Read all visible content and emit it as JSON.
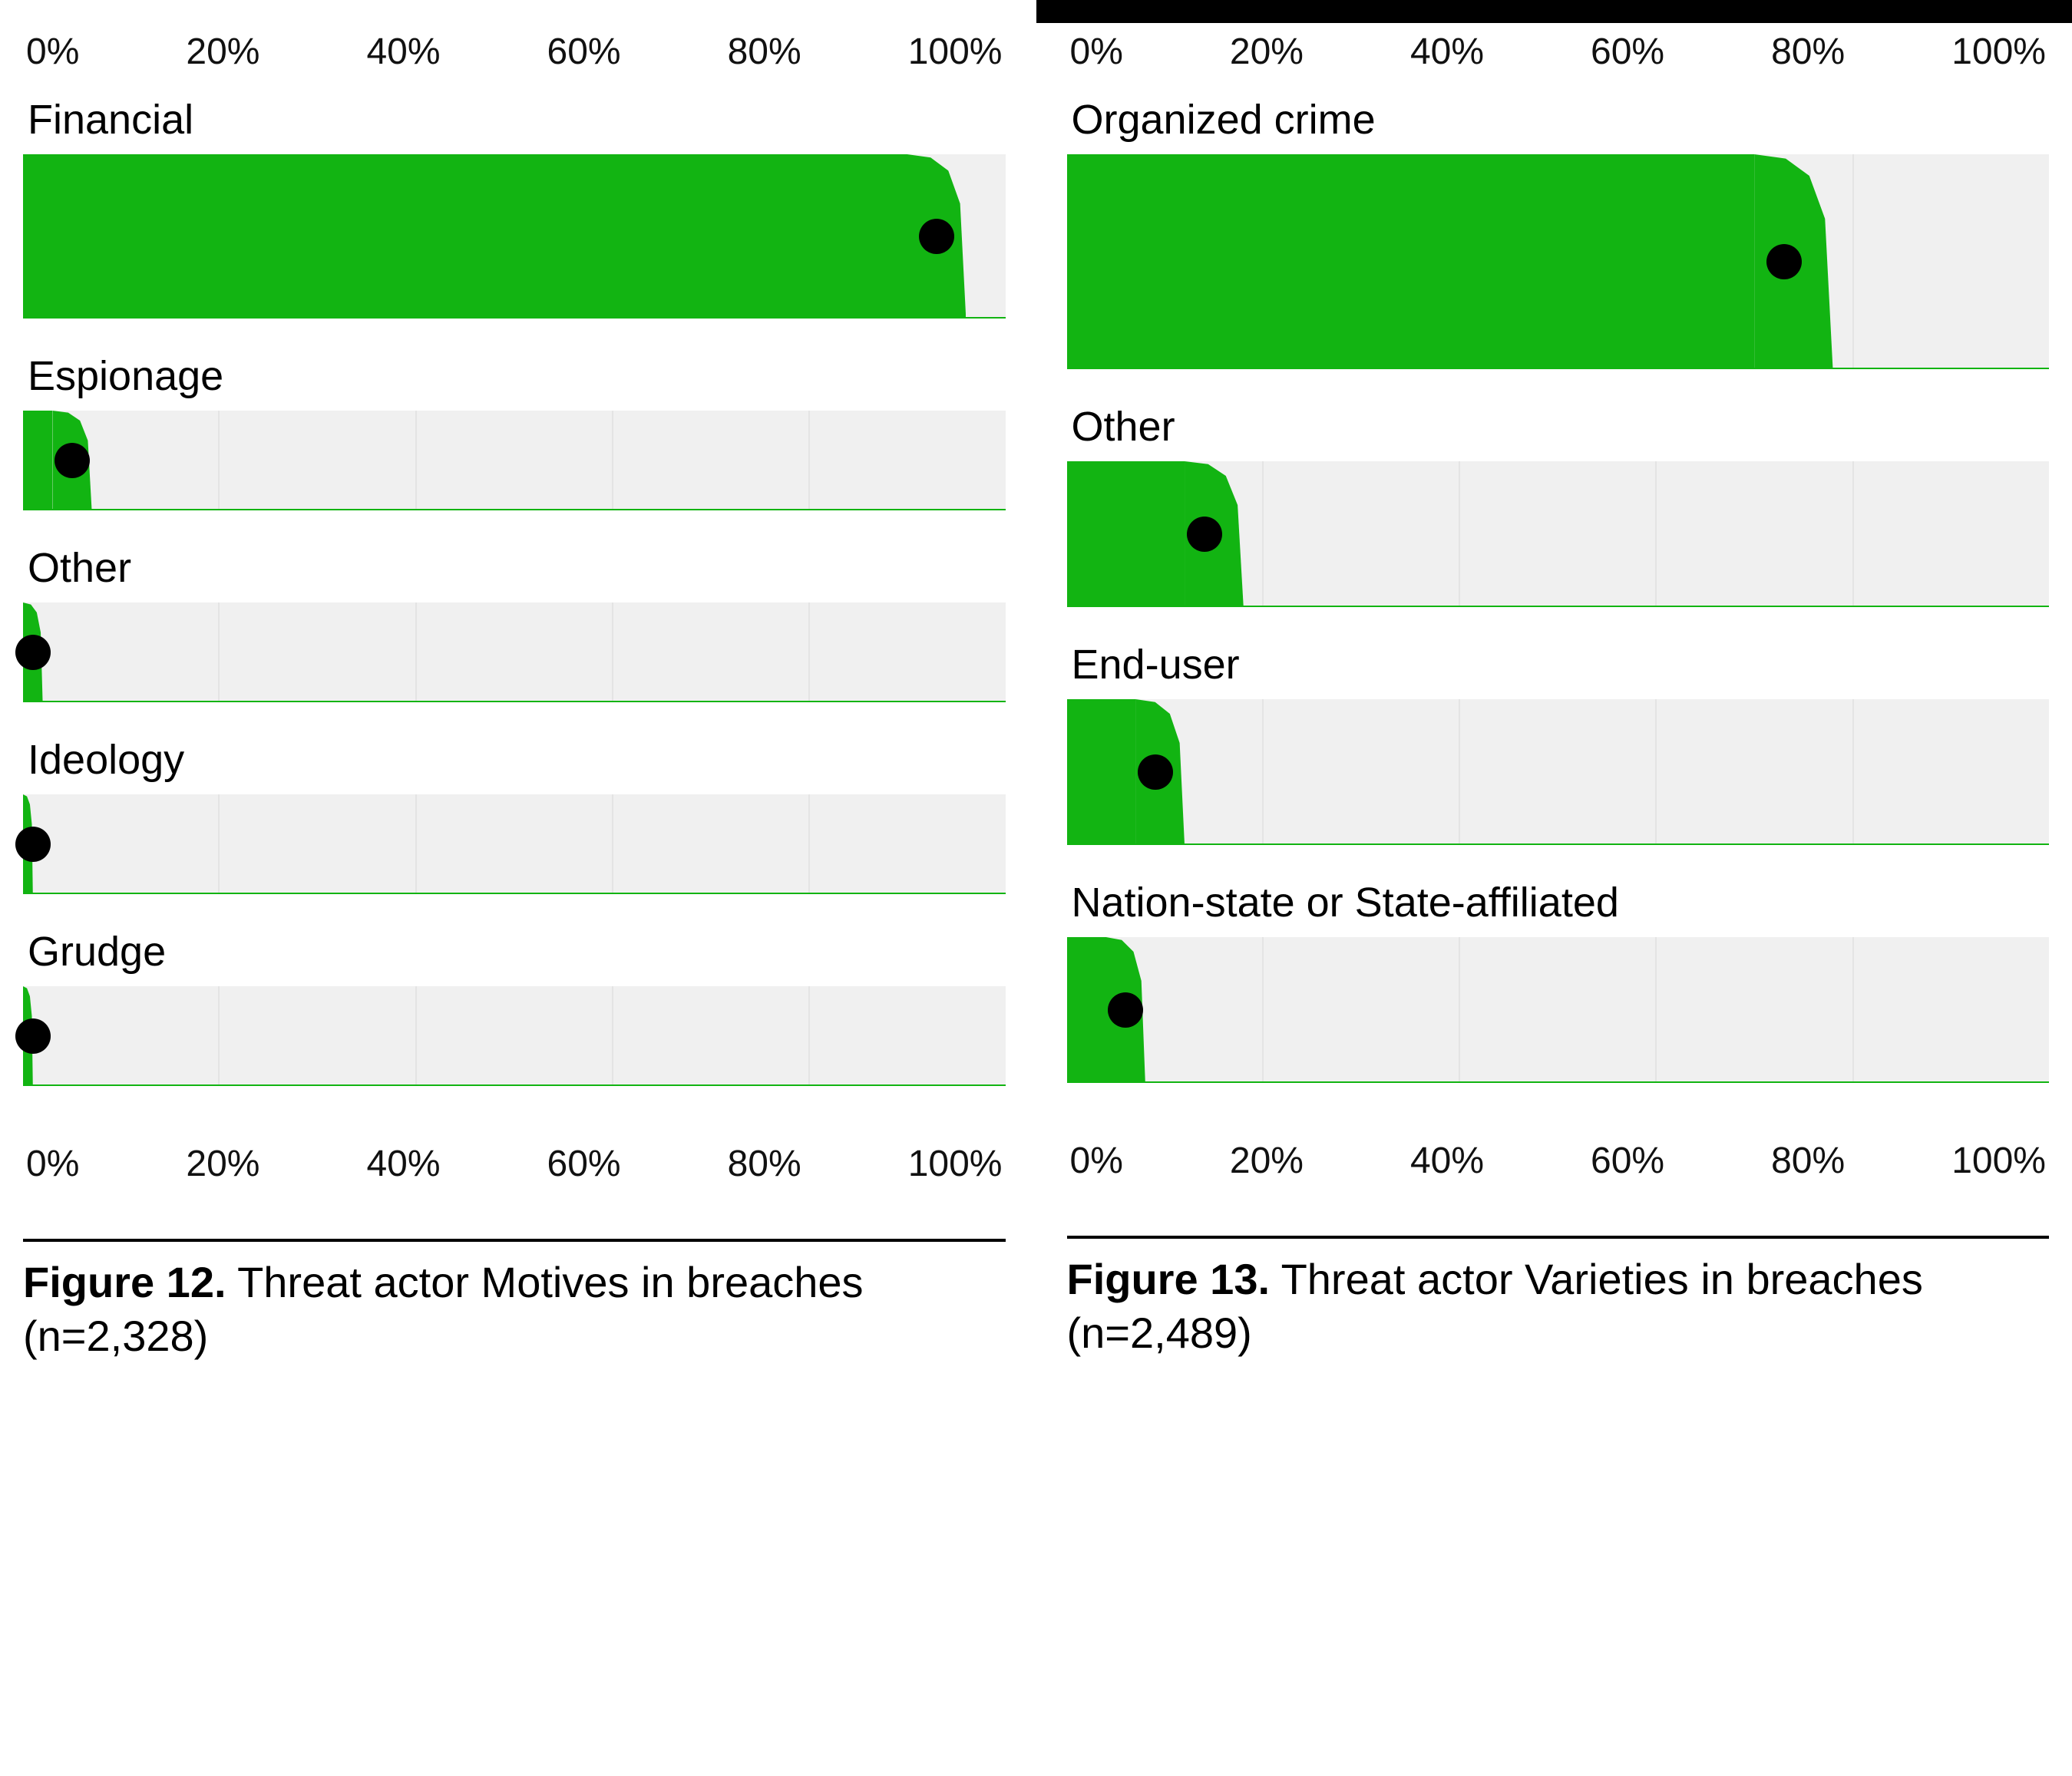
{
  "axis_ticks": [
    "0%",
    "20%",
    "40%",
    "60%",
    "80%",
    "100%"
  ],
  "colors": {
    "bar": "#12b412",
    "dot": "#000000",
    "grid_bg": "#f0f0f0"
  },
  "chart_data": [
    {
      "id": "fig12",
      "type": "bar",
      "orientation": "horizontal",
      "title": "Threat actor Motives in breaches (n=2,328)",
      "figure_label": "Figure 12.",
      "xlim": [
        0,
        100
      ],
      "x_ticks": [
        0,
        20,
        40,
        60,
        80,
        100
      ],
      "first_bar_height": 214,
      "other_bar_height": 130,
      "series": [
        {
          "name": "Financial",
          "value": 93,
          "low": 90,
          "high": 96
        },
        {
          "name": "Espionage",
          "value": 5,
          "low": 3,
          "high": 7
        },
        {
          "name": "Other",
          "value": 1,
          "low": 0,
          "high": 2
        },
        {
          "name": "Ideology",
          "value": 1,
          "low": 0,
          "high": 1
        },
        {
          "name": "Grudge",
          "value": 1,
          "low": 0,
          "high": 1
        }
      ]
    },
    {
      "id": "fig13",
      "type": "bar",
      "orientation": "horizontal",
      "title": "Threat actor Varieties in breaches (n=2,489)",
      "figure_label": "Figure 13.",
      "xlim": [
        0,
        100
      ],
      "x_ticks": [
        0,
        20,
        40,
        60,
        80,
        100
      ],
      "first_bar_height": 280,
      "other_bar_height": 190,
      "series": [
        {
          "name": "Organized crime",
          "value": 73,
          "low": 70,
          "high": 78
        },
        {
          "name": "Other",
          "value": 14,
          "low": 12,
          "high": 18
        },
        {
          "name": "End-user",
          "value": 9,
          "low": 7,
          "high": 12
        },
        {
          "name": "Nation-state or State-affiliated",
          "value": 6,
          "low": 4,
          "high": 8
        }
      ]
    }
  ]
}
